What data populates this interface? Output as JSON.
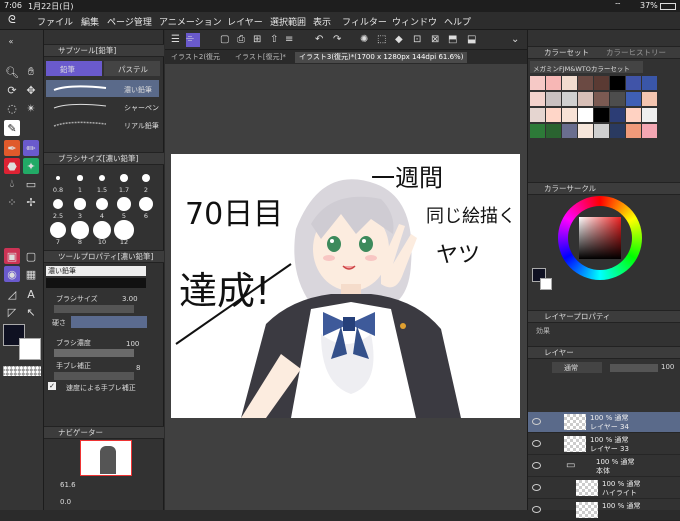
{
  "status": {
    "time": "7:06",
    "date": "1月22日(日)",
    "battery": "37%"
  },
  "menu": [
    "ファイル",
    "編集",
    "ページ管理",
    "アニメーション",
    "レイヤー",
    "選択範囲",
    "表示",
    "フィルター",
    "ウィンドウ",
    "ヘルプ"
  ],
  "subtool": {
    "title": "サブツール[鉛筆]",
    "groups": [
      "鉛筆",
      "パステル"
    ],
    "items": [
      "濃い鉛筆",
      "シャーペン",
      "リアル鉛筆"
    ]
  },
  "brushsize": {
    "title": "ブラシサイズ[濃い鉛筆]",
    "sizes": [
      "0.8",
      "1",
      "1.5",
      "1.7",
      "2",
      "2.5",
      "3",
      "4",
      "5",
      "6",
      "7",
      "8",
      "10",
      "12"
    ]
  },
  "toolprop": {
    "title": "ツールプロパティ[濃い鉛筆]",
    "name": "濃い鉛筆",
    "brush_size_label": "ブラシサイズ",
    "brush_size_value": "3.00",
    "hardness_label": "硬さ",
    "density_label": "ブラシ濃度",
    "density_value": "100",
    "stabilization_label": "手ブレ補正",
    "stabilization_value": "8",
    "speed_stab_label": "速度による手ブレ補正"
  },
  "navigator": {
    "title": "ナビゲーター",
    "zoom": "61.6",
    "angle": "0.0"
  },
  "tabs": [
    "イラスト2(復元",
    "イラスト[復元]*",
    "イラスト3(復元)*(1700 x 1280px 144dpi 61.6%)"
  ],
  "artwork": {
    "left_text_1": "70日目",
    "left_text_2": "達成!",
    "right_text_1": "一週間",
    "right_text_2": "同じ絵描く",
    "right_text_3": "ヤツ"
  },
  "colorset": {
    "tab1": "カラーセット",
    "tab2": "カラーヒストリー",
    "dropdown": "メガミンFJM&WTOカラーセット",
    "swatches": [
      "#f6c9c6",
      "#f7b7b5",
      "#f2dccf",
      "#6b4a43",
      "#5a3a33",
      "#000000",
      "#4054a8",
      "#3a56a8",
      "#f3d2cc",
      "#c9c0c0",
      "#d0d0d0",
      "#d7bfb7",
      "#7b5a52",
      "#4d4d4d",
      "#3f5fb5",
      "#f4c5b0",
      "#e5d5d0",
      "#ffd6c8",
      "#f7e2d6",
      "#ffffff",
      "#000000",
      "#2c3d75",
      "#ffd2c2",
      "#efefef",
      "#2d7a38",
      "#2a6330",
      "#6a6e8f",
      "#f6e6db",
      "#cfcfcf",
      "#2a3a60",
      "#f09a7a",
      "#f4a7b3"
    ]
  },
  "colorcircle": {
    "title": "カラーサークル",
    "main": "#0f1122",
    "sub": "#ffffff"
  },
  "layerprop": {
    "title": "レイヤープロパティ",
    "effect_label": "効果"
  },
  "layers": {
    "title": "レイヤー",
    "blend": "通常",
    "opacity": "100",
    "rows": [
      {
        "line1": "100 % 通常",
        "line2": "レイヤー 34"
      },
      {
        "line1": "100 % 通常",
        "line2": "レイヤー 33"
      },
      {
        "line1": "100 % 通常",
        "line2": "本体"
      },
      {
        "line1": "100 % 通常",
        "line2": "ハイライト"
      },
      {
        "line1": "100 % 通常",
        "line2": ""
      }
    ]
  }
}
